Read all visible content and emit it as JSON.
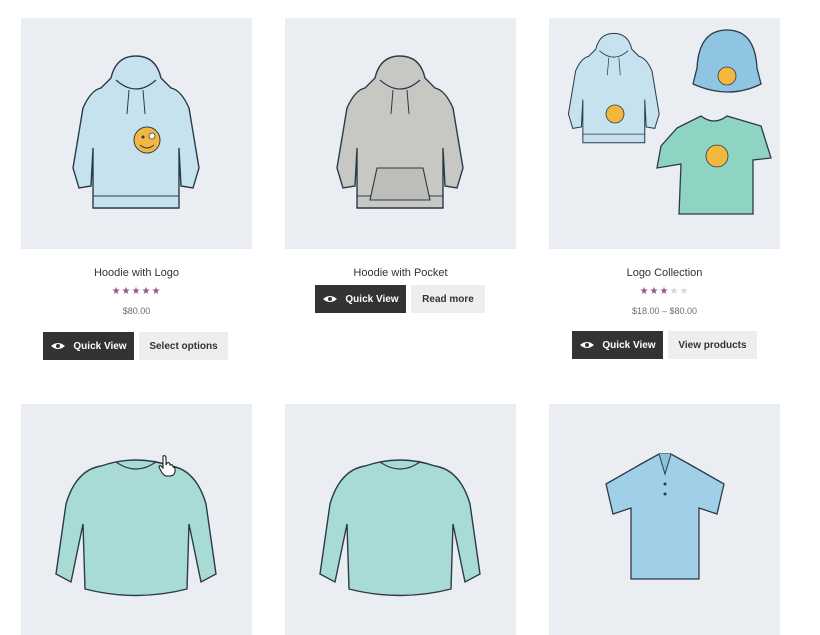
{
  "products": [
    {
      "title": "Hoodie with Logo",
      "rating": "5 of 5",
      "price": "$80.00",
      "quick_view": "Quick View",
      "action": "Select options",
      "image_icon": "hoodie-logo-icon"
    },
    {
      "title": "Hoodie with Pocket",
      "quick_view": "Quick View",
      "action": "Read more",
      "image_icon": "hoodie-pocket-icon"
    },
    {
      "title": "Logo Collection",
      "rating": "3 of 5",
      "price": "$18.00 – $80.00",
      "quick_view": "Quick View",
      "action": "View products",
      "image_icon": "logo-collection-icon"
    },
    {
      "image_icon": "long-sleeve-tee-icon"
    },
    {
      "image_icon": "long-sleeve-tee-icon"
    },
    {
      "image_icon": "polo-icon"
    }
  ],
  "colors": {
    "thumb_bg": "#eaeef2",
    "button_dark": "#333333",
    "button_light": "#eeeeee",
    "star": "#96588a"
  }
}
